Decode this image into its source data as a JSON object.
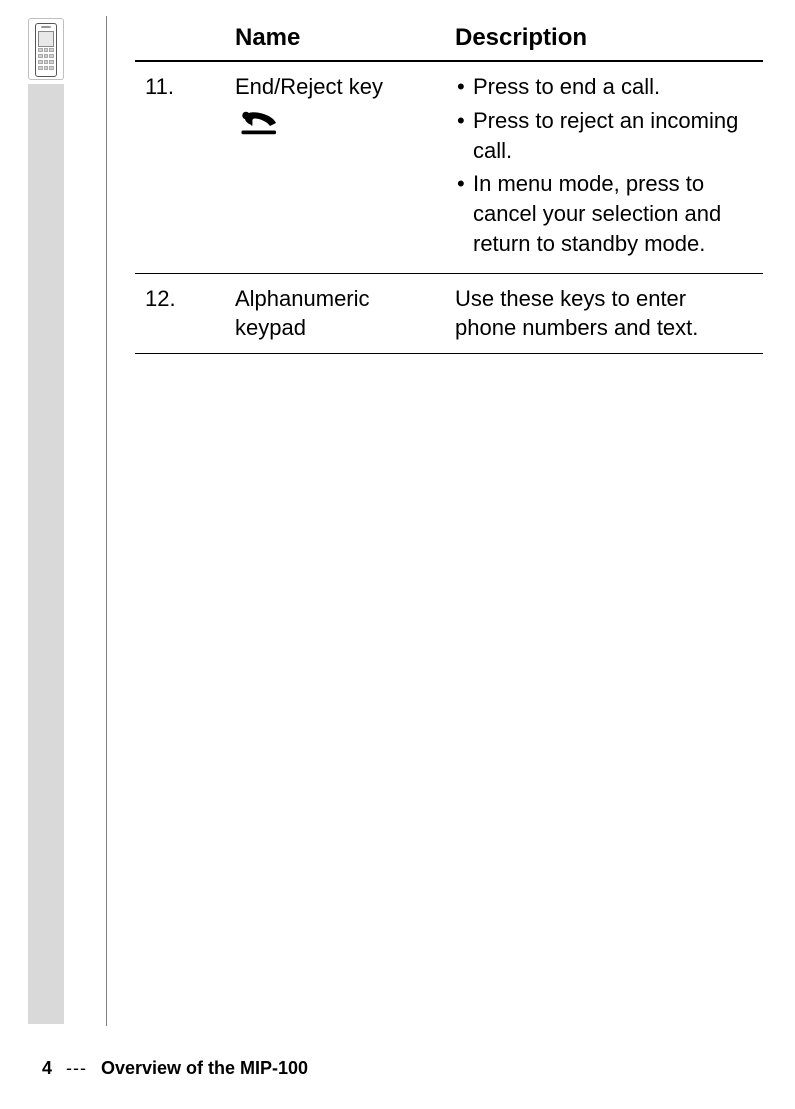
{
  "table": {
    "headers": {
      "number": "",
      "name": "Name",
      "description": "Description"
    },
    "rows": [
      {
        "num": "11.",
        "name": "End/Reject key",
        "bullets": [
          "Press to end a call.",
          "Press to reject an incoming call.",
          "In menu mode, press to cancel your selection and return to standby mode."
        ]
      },
      {
        "num": "12.",
        "name": "Alphanumeric keypad",
        "description_plain": "Use these keys to enter phone numbers and text."
      }
    ]
  },
  "footer": {
    "page_number": "4",
    "separator": "---",
    "title": "Overview of the MIP-100"
  }
}
